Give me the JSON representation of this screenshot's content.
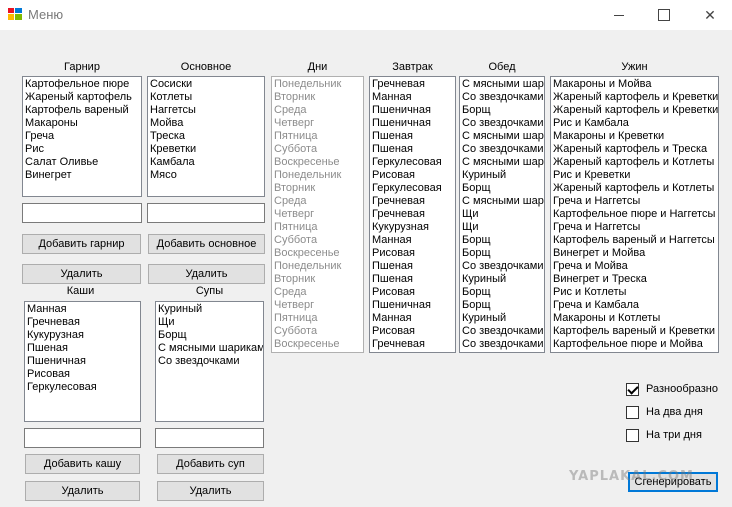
{
  "window": {
    "title": "Меню"
  },
  "labels": {
    "garnish": "Гарнир",
    "main": "Основное",
    "days": "Дни",
    "breakfast": "Завтрак",
    "lunch": "Обед",
    "dinner": "Ужин",
    "porridge": "Каши",
    "soups": "Супы"
  },
  "garnish_items": [
    "Картофельное пюре",
    "Жареный картофель",
    "Картофель вареный",
    "Макароны",
    "Греча",
    "Рис",
    "Салат Оливье",
    "Винегрет"
  ],
  "main_items": [
    "Сосиски",
    "Котлеты",
    "Наггетсы",
    "Мойва",
    "Треска",
    "Креветки",
    "Камбала",
    "Мясо"
  ],
  "days_items": [
    "Понедельник",
    "Вторник",
    "Среда",
    "Четверг",
    "Пятница",
    "Суббота",
    "Воскресенье",
    "Понедельник",
    "Вторник",
    "Среда",
    "Четверг",
    "Пятница",
    "Суббота",
    "Воскресенье",
    "Понедельник",
    "Вторник",
    "Среда",
    "Четверг",
    "Пятница",
    "Суббота",
    "Воскресенье"
  ],
  "breakfast_items": [
    "Гречневая",
    "Манная",
    "Пшеничная",
    "Пшеничная",
    "Пшеная",
    "Пшеная",
    "Геркулесовая",
    "Рисовая",
    "Геркулесовая",
    "Гречневая",
    "Гречневая",
    "Кукурузная",
    "Манная",
    "Рисовая",
    "Пшеная",
    "Пшеная",
    "Рисовая",
    "Пшеничная",
    "Манная",
    "Рисовая",
    "Гречневая"
  ],
  "lunch_items": [
    "С мясными шар",
    "Со звездочками",
    "Борщ",
    "Со звездочками",
    "С мясными шар",
    "Со звездочками",
    "С мясными шар",
    "Куриный",
    "Борщ",
    "С мясными шар",
    "Щи",
    "Щи",
    "Борщ",
    "Борщ",
    "Со звездочками",
    "Куриный",
    "Борщ",
    "Борщ",
    "Куриный",
    "Со звездочками",
    "Со звездочками"
  ],
  "dinner_items": [
    "Макароны и Мойва",
    "Жареный картофель и Креветки",
    "Жареный картофель и Креветки",
    "Рис и Камбала",
    "Макароны и Креветки",
    "Жареный картофель и Треска",
    "Жареный картофель и Котлеты",
    "Рис и Креветки",
    "Жареный картофель и Котлеты",
    "Греча и Наггетсы",
    "Картофельное пюре и Наггетсы",
    "Греча и Наггетсы",
    "Картофель вареный и Наггетсы",
    "Винегрет и Мойва",
    "Греча и Мойва",
    "Винегрет и Треска",
    "Рис и Котлеты",
    "Греча и Камбала",
    "Макароны и Котлеты",
    "Картофель вареный и Креветки",
    "Картофельное пюре и Мойва"
  ],
  "porridge_items": [
    "Манная",
    "Гречневая",
    "Кукурузная",
    "Пшеная",
    "Пшеничная",
    "Рисовая",
    "Геркулесовая"
  ],
  "soup_items": [
    "Куриный",
    "Щи",
    "Борщ",
    "С мясными шарикам",
    "Со звездочками"
  ],
  "buttons": {
    "add_garnish": "Добавить гарнир",
    "add_main": "Добавить основное",
    "delete": "Удалить",
    "add_porridge": "Добавить кашу",
    "add_soup": "Добавить суп",
    "generate": "Сгенерировать"
  },
  "checkboxes": {
    "variety": {
      "label": "Разнообразно",
      "checked": true
    },
    "two_days": {
      "label": "На два дня",
      "checked": false
    },
    "three_days": {
      "label": "На три дня",
      "checked": false
    }
  },
  "watermark": "YAPLAKAL.COM"
}
